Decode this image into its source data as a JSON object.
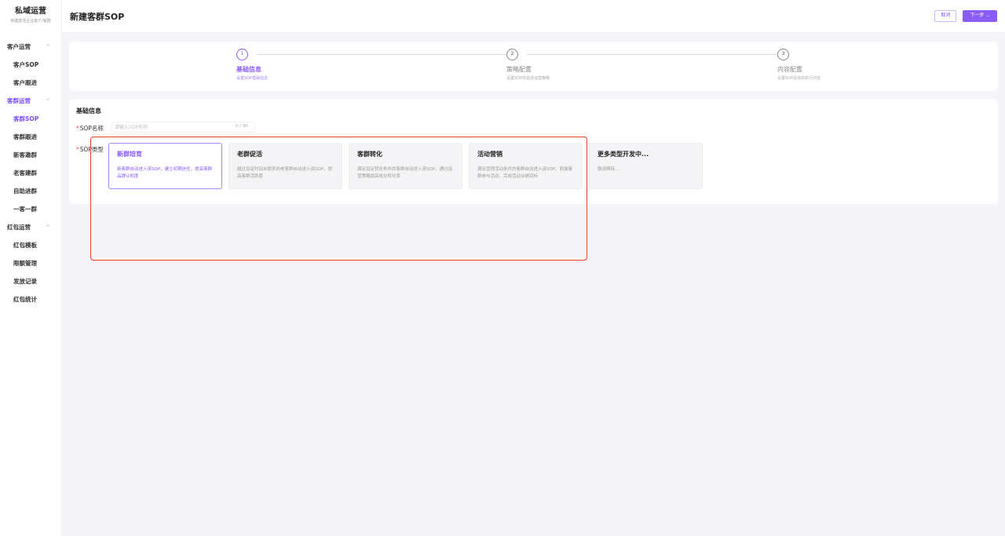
{
  "sidebar": {
    "brand_title": "私域运营",
    "brand_subtitle": "快捷激活企业客户/客群",
    "groups": [
      {
        "label": "客户运营",
        "items": [
          "客户SOP",
          "客户跟进"
        ]
      },
      {
        "label": "客群运营",
        "items": [
          "客群SOP",
          "客群跟进",
          "新客邀群",
          "老客建群",
          "自助进群",
          "一客一群"
        ]
      },
      {
        "label": "红包运营",
        "items": [
          "红包模板",
          "限额管理",
          "发放记录",
          "红包统计"
        ]
      }
    ],
    "active_item": "客群SOP",
    "accent_color": "#7c4dff"
  },
  "header": {
    "title": "新建客群SOP",
    "cancel_label": "取消",
    "next_label": "下一步 →"
  },
  "steps": [
    {
      "number": "1",
      "title": "基础信息",
      "desc": "设置SOP基础信息",
      "active": true
    },
    {
      "number": "2",
      "title": "策略配置",
      "desc": "设置SOP的具体运营策略",
      "active": false
    },
    {
      "number": "3",
      "title": "内容配置",
      "desc": "设置SOP具体的执行内容",
      "active": false
    }
  ],
  "form": {
    "section_title": "基础信息",
    "name_label": "SOP名称",
    "name_placeholder": "请输入SOP名称",
    "name_value": "",
    "name_counter": "0 / 30",
    "type_label": "SOP类型",
    "types": [
      {
        "title": "新群培育",
        "desc": "新客群自动进入该SOP，建立初期信任，提高客群品牌认知度",
        "active": true
      },
      {
        "title": "老群促活",
        "desc": "超过设定时间未联系的老客群自动进入该SOP，提高客群活跃度",
        "active": false
      },
      {
        "title": "客群转化",
        "desc": "满足设定转化条件的客群自动进入该SOP，通过运营策略提高成交转化率",
        "active": false
      },
      {
        "title": "活动营销",
        "desc": "满足营销活动条件的客群自动进入该SOP，刺激客群参与活动，完成活动业绩目标",
        "active": false
      },
      {
        "title": "更多类型开发中...",
        "desc": "敬请期待...",
        "active": false
      }
    ]
  },
  "highlight_color": "#f03c2e"
}
